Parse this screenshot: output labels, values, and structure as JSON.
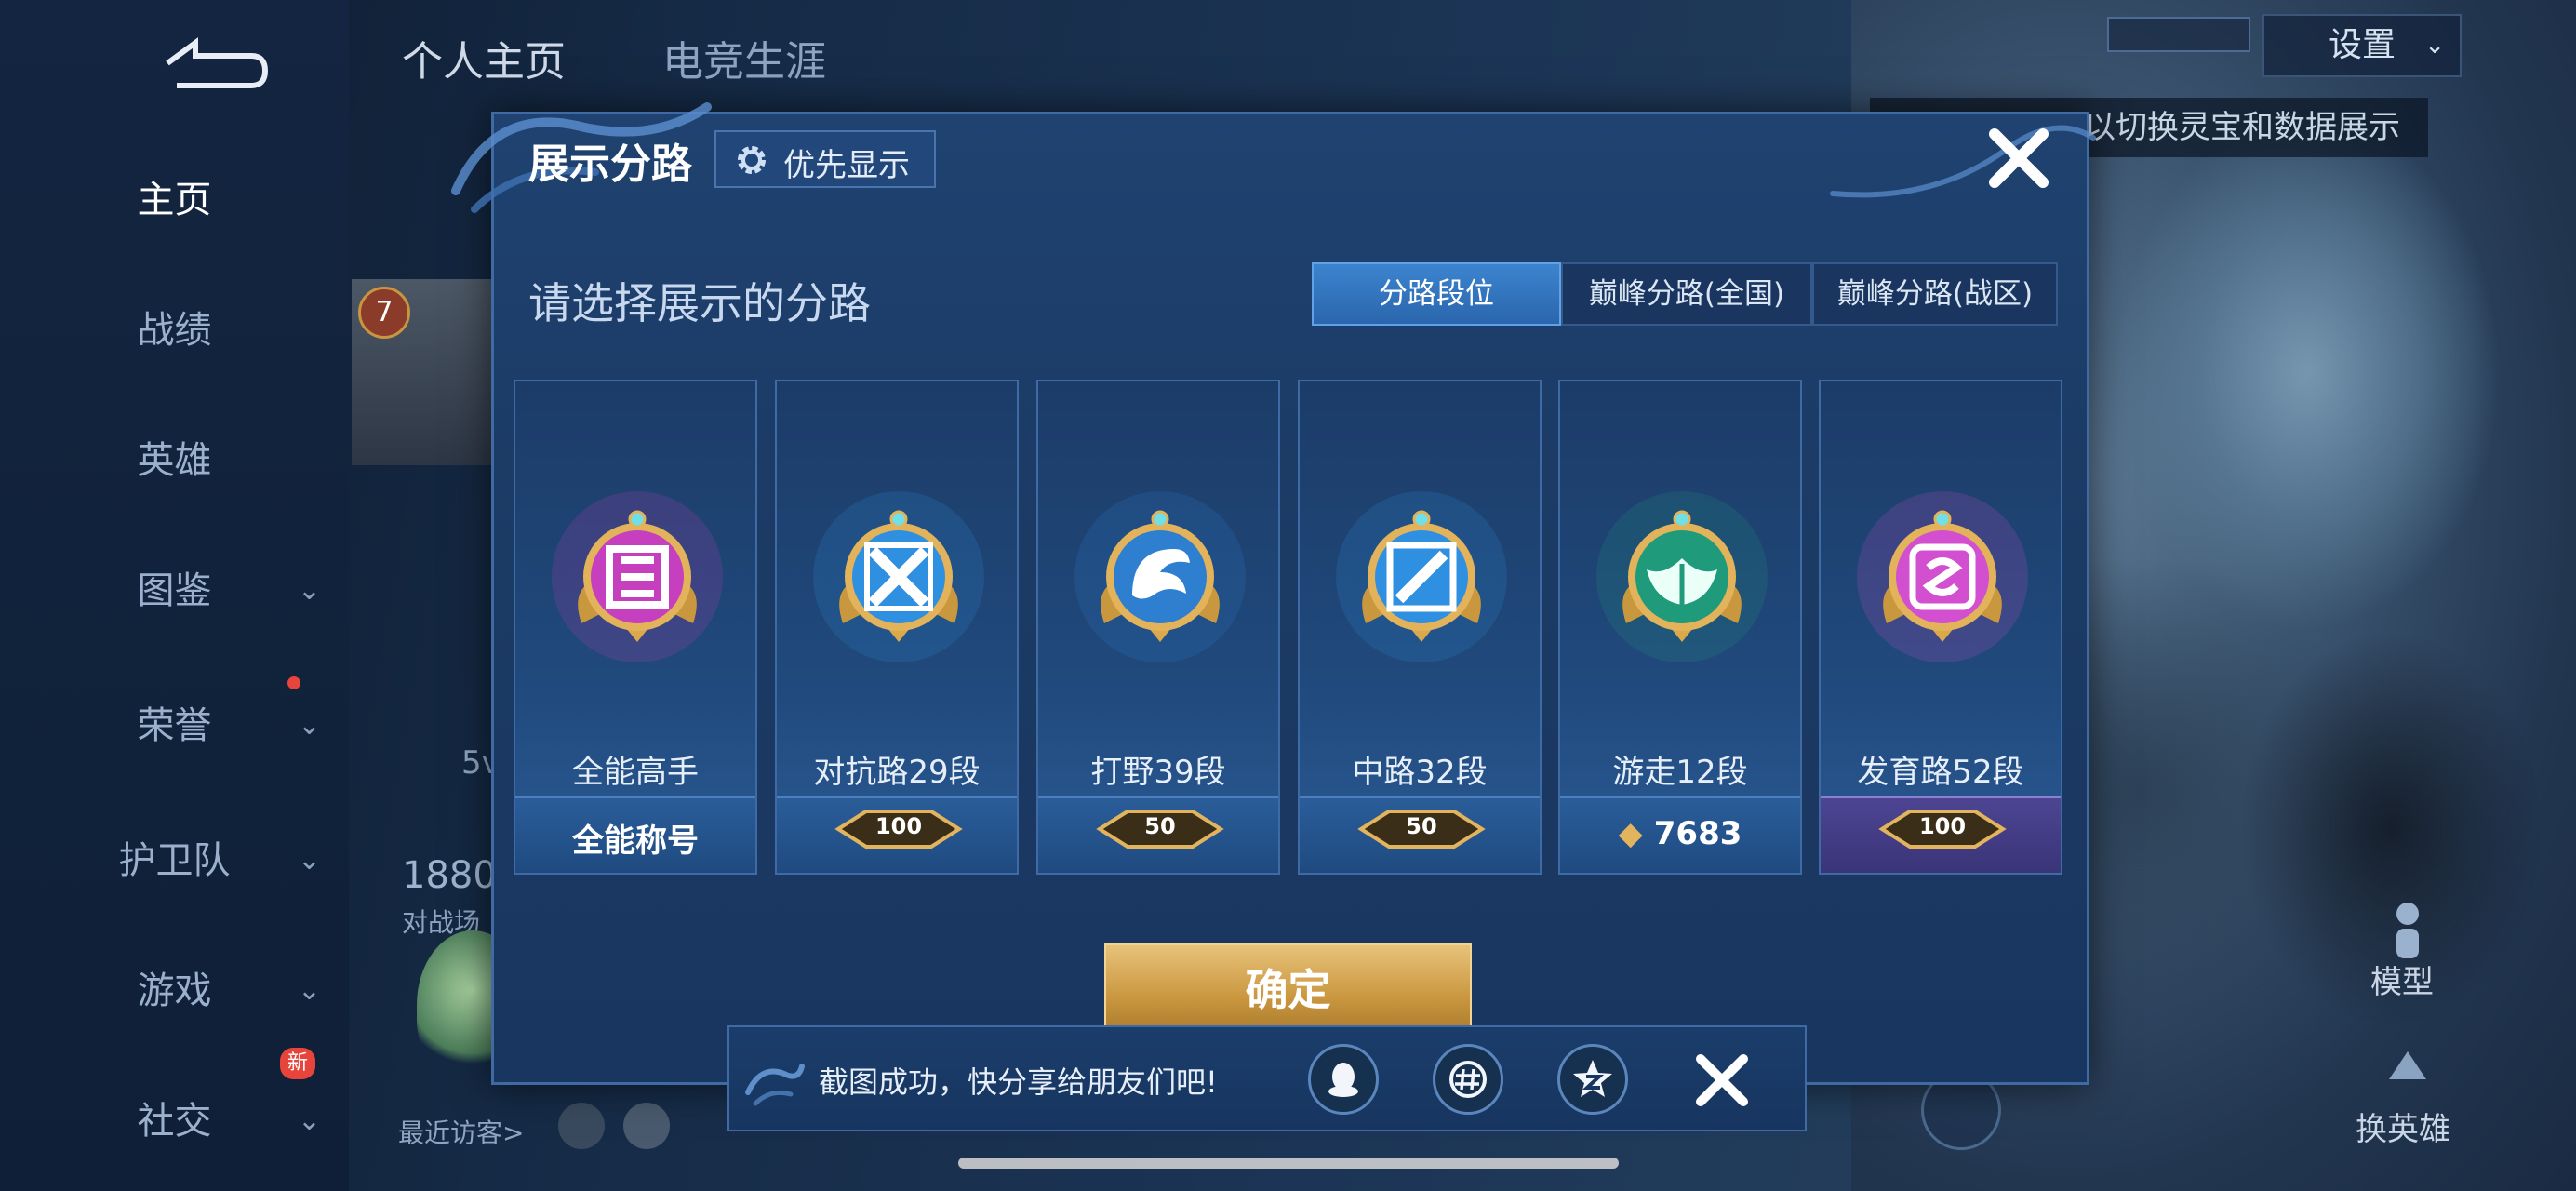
{
  "header": {
    "tabs": [
      "个人主页",
      "电竞生涯"
    ],
    "settings_label": "设置",
    "hint_text": "以切换灵宝和数据展示"
  },
  "sidebar": {
    "items": [
      {
        "label": "主页",
        "active": true,
        "chevron": false
      },
      {
        "label": "战绩",
        "active": false,
        "chevron": false
      },
      {
        "label": "英雄",
        "active": false,
        "chevron": false
      },
      {
        "label": "图鉴",
        "active": false,
        "chevron": true
      },
      {
        "label": "荣誉",
        "active": false,
        "chevron": true
      },
      {
        "label": "护卫队",
        "active": false,
        "chevron": true
      },
      {
        "label": "游戏",
        "active": false,
        "chevron": true
      },
      {
        "label": "社交",
        "active": false,
        "chevron": true
      }
    ],
    "new_badge": "新"
  },
  "background": {
    "level_badge": "7",
    "partial_text_1": "5v",
    "partial_number": "1880",
    "partial_text_2": "对战场",
    "recent_visitors": "最近访客>",
    "model_label": "模型",
    "change_hero_label": "换英雄"
  },
  "modal": {
    "title": "展示分路",
    "priority_button": "优先显示",
    "subtitle": "请选择展示的分路",
    "segments": [
      {
        "label": "分路段位",
        "active": true
      },
      {
        "label": "巅峰分路(全国)",
        "active": false
      },
      {
        "label": "巅峰分路(战区)",
        "active": false
      }
    ],
    "cards": [
      {
        "role": "全能高手",
        "footer_text": "全能称号",
        "star_count": null,
        "color": "#c53fbf",
        "icon": "allround-icon"
      },
      {
        "role": "对抗路29段",
        "footer_text": null,
        "star_count": "100",
        "color": "#2f8fe0",
        "icon": "clash-lane-icon"
      },
      {
        "role": "打野39段",
        "footer_text": null,
        "star_count": "50",
        "color": "#2f7fd0",
        "icon": "jungle-dragon-icon"
      },
      {
        "role": "中路32段",
        "footer_text": null,
        "star_count": "50",
        "color": "#2f8fe0",
        "icon": "mid-lane-icon"
      },
      {
        "role": "游走12段",
        "footer_text": "7683",
        "star_count": null,
        "color": "#1f9a7a",
        "icon": "roam-wings-icon"
      },
      {
        "role": "发育路52段",
        "footer_text": null,
        "star_count": "100",
        "color": "#d24fcf",
        "icon": "farm-lane-icon"
      }
    ],
    "confirm": "确定"
  },
  "toast": {
    "message": "截图成功，快分享给朋友们吧!",
    "share_icons": [
      "qq-icon",
      "hashtag-icon",
      "qzone-icon"
    ]
  }
}
